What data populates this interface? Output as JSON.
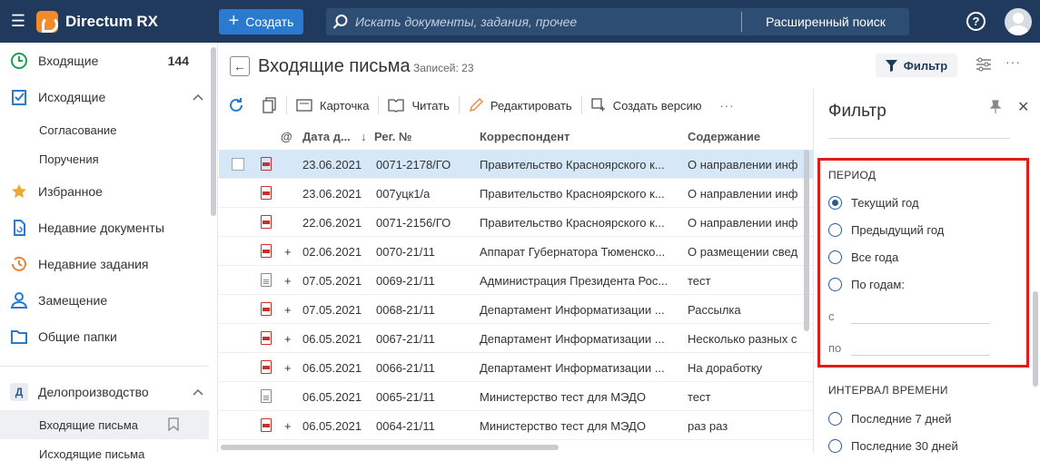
{
  "app": {
    "name": "Directum RX",
    "create_label": "Создать"
  },
  "search": {
    "placeholder": "Искать документы, задания, прочее",
    "advanced_label": "Расширенный поиск"
  },
  "sidebar": {
    "items": [
      {
        "label": "Входящие",
        "count": "144"
      },
      {
        "label": "Исходящие"
      },
      {
        "label": "Избранное"
      },
      {
        "label": "Недавние документы"
      },
      {
        "label": "Недавние задания"
      },
      {
        "label": "Замещение"
      },
      {
        "label": "Общие папки"
      }
    ],
    "sub_outgoing": [
      "Согласование",
      "Поручения"
    ],
    "group": {
      "badge": "Д",
      "label": "Делопроизводство"
    },
    "group_items": [
      "Входящие письма",
      "Исходящие письма"
    ]
  },
  "main": {
    "title": "Входящие письма",
    "count": "Записей: 23",
    "filter_label": "Фильтр",
    "toolbar": [
      "Карточка",
      "Читать",
      "Редактировать",
      "Создать версию"
    ],
    "columns": {
      "at": "@",
      "date": "Дата д...",
      "reg": "Рег. №",
      "correspondent": "Корреспондент",
      "content": "Содержание"
    },
    "rows": [
      {
        "plus": "",
        "date": "23.06.2021",
        "reg": "0071-2178/ГО",
        "corr": "Правительство Красноярского к...",
        "content": "О направлении инф",
        "icon": "pdf",
        "selected": true
      },
      {
        "plus": "",
        "date": "23.06.2021",
        "reg": "007уцк1/а",
        "corr": "Правительство Красноярского к...",
        "content": "О направлении инф",
        "icon": "pdf"
      },
      {
        "plus": "",
        "date": "22.06.2021",
        "reg": "0071-2156/ГО",
        "corr": "Правительство Красноярского к...",
        "content": "О направлении инф",
        "icon": "pdf"
      },
      {
        "plus": "+",
        "date": "02.06.2021",
        "reg": "0070-21/11",
        "corr": "Аппарат Губернатора Тюменско...",
        "content": "О размещении свед",
        "icon": "pdf"
      },
      {
        "plus": "+",
        "date": "07.05.2021",
        "reg": "0069-21/11",
        "corr": "Администрация Президента Рос...",
        "content": "тест",
        "icon": "doc"
      },
      {
        "plus": "+",
        "date": "07.05.2021",
        "reg": "0068-21/11",
        "corr": "Департамент Информатизации ...",
        "content": "Рассылка",
        "icon": "pdf"
      },
      {
        "plus": "+",
        "date": "06.05.2021",
        "reg": "0067-21/11",
        "corr": "Департамент Информатизации ...",
        "content": "Несколько разных с",
        "icon": "pdf"
      },
      {
        "plus": "+",
        "date": "06.05.2021",
        "reg": "0066-21/11",
        "corr": "Департамент Информатизации ...",
        "content": "На доработку",
        "icon": "pdf"
      },
      {
        "plus": "",
        "date": "06.05.2021",
        "reg": "0065-21/11",
        "corr": "Министерство тест для МЭДО",
        "content": "тест",
        "icon": "doc"
      },
      {
        "plus": "+",
        "date": "06.05.2021",
        "reg": "0064-21/11",
        "corr": "Министерство тест для МЭДО",
        "content": "раз раз",
        "icon": "pdf"
      }
    ]
  },
  "filter": {
    "title": "Фильтр",
    "period_title": "ПЕРИОД",
    "period_options": [
      "Текущий год",
      "Предыдущий год",
      "Все года",
      "По годам:"
    ],
    "from_label": "с",
    "to_label": "по",
    "interval_title": "ИНТЕРВАЛ ВРЕМЕНИ",
    "interval_options": [
      "Последние 7 дней",
      "Последние 30 дней"
    ]
  }
}
